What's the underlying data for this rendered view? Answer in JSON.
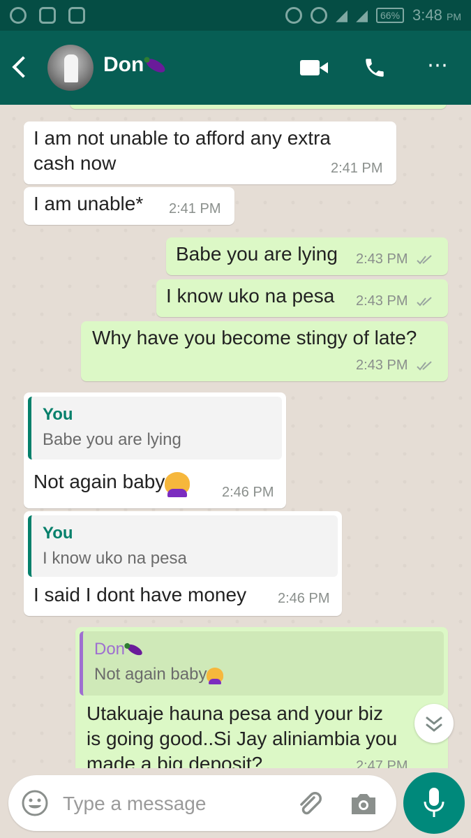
{
  "status_bar": {
    "battery": "66%",
    "time": "3:48",
    "ampm": "PM"
  },
  "header": {
    "contact_name": "Don",
    "icons": [
      "back-arrow-icon",
      "avatar",
      "eggplant-emoji",
      "video-call-icon",
      "phone-call-icon",
      "more-options-icon"
    ]
  },
  "messages": [
    {
      "dir": "in",
      "text_l1": "I am not unable to afford any extra",
      "text_l2": "cash now",
      "time": "2:41 PM"
    },
    {
      "dir": "in",
      "text": "I am unable*",
      "time": "2:41 PM"
    },
    {
      "dir": "out",
      "text": "Babe you are lying",
      "time": "2:43 PM"
    },
    {
      "dir": "out",
      "text": "I know uko na pesa",
      "time": "2:43 PM"
    },
    {
      "dir": "out",
      "text": "Why have you become stingy of late?",
      "time": "2:43 PM"
    },
    {
      "dir": "in",
      "quote_author": "You",
      "quote_text": "Babe you are lying",
      "text": "Not again baby",
      "time": "2:46 PM"
    },
    {
      "dir": "in",
      "quote_author": "You",
      "quote_text": "I know uko na pesa",
      "text": "I said I dont have money",
      "time": "2:46 PM"
    },
    {
      "dir": "out",
      "quote_author": "Don",
      "quote_text": "Not again baby",
      "text_l1": "Utakuaje hauna pesa and your biz",
      "text_l2": "is going good..Si Jay aliniambia you",
      "text_l3": "made a big deposit?",
      "time": "2:47 PM"
    }
  ],
  "composer": {
    "placeholder": "Type a message"
  },
  "colors": {
    "header": "#075e54",
    "status_bar": "#054d44",
    "outgoing_bubble": "#dcf8c6",
    "incoming_bubble": "#ffffff",
    "mic_button": "#00897b",
    "read_ticks": "#9aa5a0"
  }
}
